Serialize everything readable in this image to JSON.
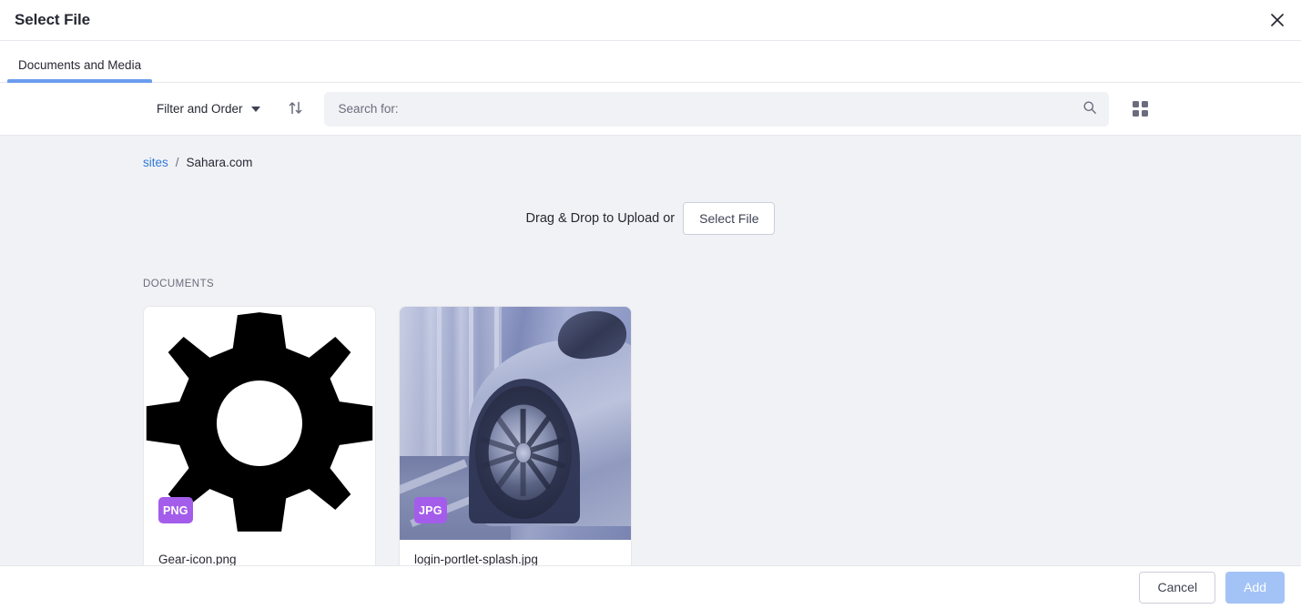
{
  "header": {
    "title": "Select File",
    "close_icon": "close-icon"
  },
  "tabs": [
    {
      "label": "Documents and Media",
      "active": true
    }
  ],
  "toolbar": {
    "filter_label": "Filter and Order",
    "caret_icon": "chevron-down-icon",
    "sort_icon": "sort-arrows-icon",
    "search_placeholder": "Search for:",
    "search_value": "",
    "search_icon": "search-icon",
    "grid_view_icon": "grid-view-icon"
  },
  "breadcrumb": {
    "root_label": "sites",
    "separator": "/",
    "current_label": "Sahara.com"
  },
  "dropzone": {
    "text": "Drag & Drop to Upload or",
    "button_label": "Select File"
  },
  "section": {
    "label": "DOCUMENTS"
  },
  "files": [
    {
      "name": "Gear-icon.png",
      "type_badge": "PNG",
      "thumb": "gear-icon"
    },
    {
      "name": "login-portlet-splash.jpg",
      "type_badge": "JPG",
      "thumb": "car-photo"
    }
  ],
  "footer": {
    "cancel_label": "Cancel",
    "add_label": "Add"
  },
  "colors": {
    "accent": "#6b9ced",
    "link": "#2f7bdb",
    "badge_purple": "#a45deb",
    "body_bg": "#f1f2f5",
    "text": "#272833",
    "muted_text": "#6b6c7e",
    "border": "#e7e7ed",
    "primary_disabled": "#a3c3f7"
  }
}
